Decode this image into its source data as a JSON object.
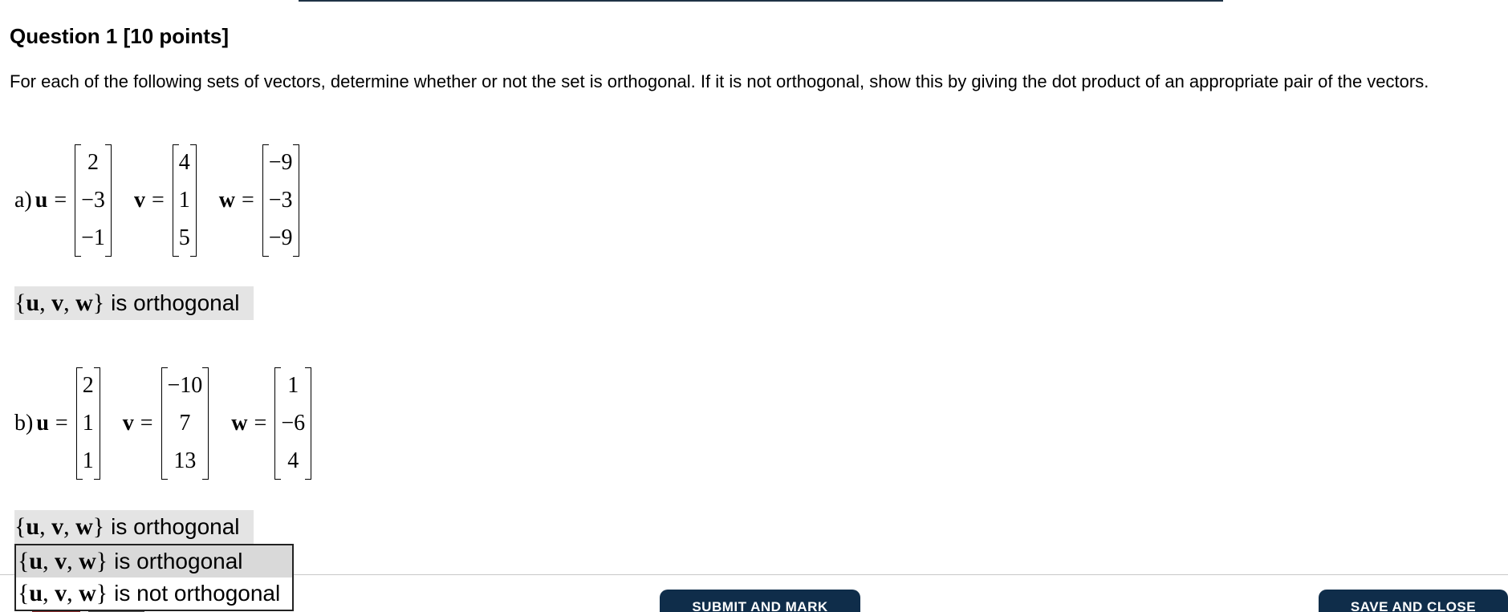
{
  "question": {
    "title": "Question 1 [10 points]",
    "text": "For each of the following sets of vectors, determine whether or not the set is orthogonal. If it is not orthogonal, show this by giving the dot product of an appropriate pair of the vectors."
  },
  "parts": [
    {
      "label": "a)",
      "vectors": [
        {
          "name": "u",
          "values": [
            "2",
            "−3",
            "−1"
          ]
        },
        {
          "name": "v",
          "values": [
            "4",
            "1",
            "5"
          ]
        },
        {
          "name": "w",
          "values": [
            "−9",
            "−3",
            "−9"
          ]
        }
      ],
      "answer": {
        "set": "{u, v, w}",
        "text": "is orthogonal"
      }
    },
    {
      "label": "b)",
      "vectors": [
        {
          "name": "u",
          "values": [
            "2",
            "1",
            "1"
          ]
        },
        {
          "name": "v",
          "values": [
            "−10",
            "7",
            "13"
          ]
        },
        {
          "name": "w",
          "values": [
            "1",
            "−6",
            "4"
          ]
        }
      ],
      "answer": {
        "set": "{u, v, w}",
        "text": "is orthogonal"
      }
    }
  ],
  "dropdown": {
    "options": [
      {
        "set": "{u, v, w}",
        "text": "is orthogonal"
      },
      {
        "set": "{u, v, w}",
        "text": "is not orthogonal"
      }
    ]
  },
  "buttons": {
    "submit": "SUBMIT AND MARK",
    "save": "SAVE AND CLOSE"
  },
  "colors": {
    "button_bg": "#0f2d4a",
    "answer_bg": "#e4e4e4",
    "selected_option_bg": "#d9d9d9"
  }
}
